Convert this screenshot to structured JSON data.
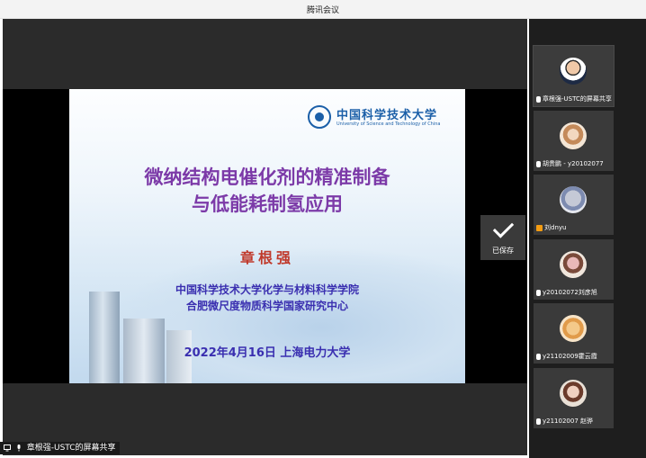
{
  "app": {
    "title": "腾讯会议"
  },
  "slide": {
    "logo_cn": "中国科学技术大学",
    "logo_en": "University of Science and Technology of China",
    "title_line1": "微纳结构电催化剂的精准制备",
    "title_line2": "与低能耗制氢应用",
    "author": "章根强",
    "affiliation1": "中国科学技术大学化学与材料科学学院",
    "affiliation2": "合肥微尺度物质科学国家研究中心",
    "date_venue": "2022年4月16日   上海电力大学"
  },
  "saved_toast": {
    "label": "已保存",
    "icon": "check-icon"
  },
  "share_indicator": {
    "label": "章根强-USTC的屏幕共享"
  },
  "participants": [
    {
      "name": "章根强-USTC的屏幕共享",
      "icon": "screen-share-icon",
      "active": true
    },
    {
      "name": "胡贵鹏 - y20102077",
      "icon": "mic-icon"
    },
    {
      "name": "刘dnyu",
      "icon": "camera-icon"
    },
    {
      "name": "y20102072刘彦旭",
      "icon": "mic-icon"
    },
    {
      "name": "y21102009霍云霞",
      "icon": "mic-icon"
    },
    {
      "name": "y21102007 赵骅",
      "icon": "mic-icon"
    }
  ]
}
